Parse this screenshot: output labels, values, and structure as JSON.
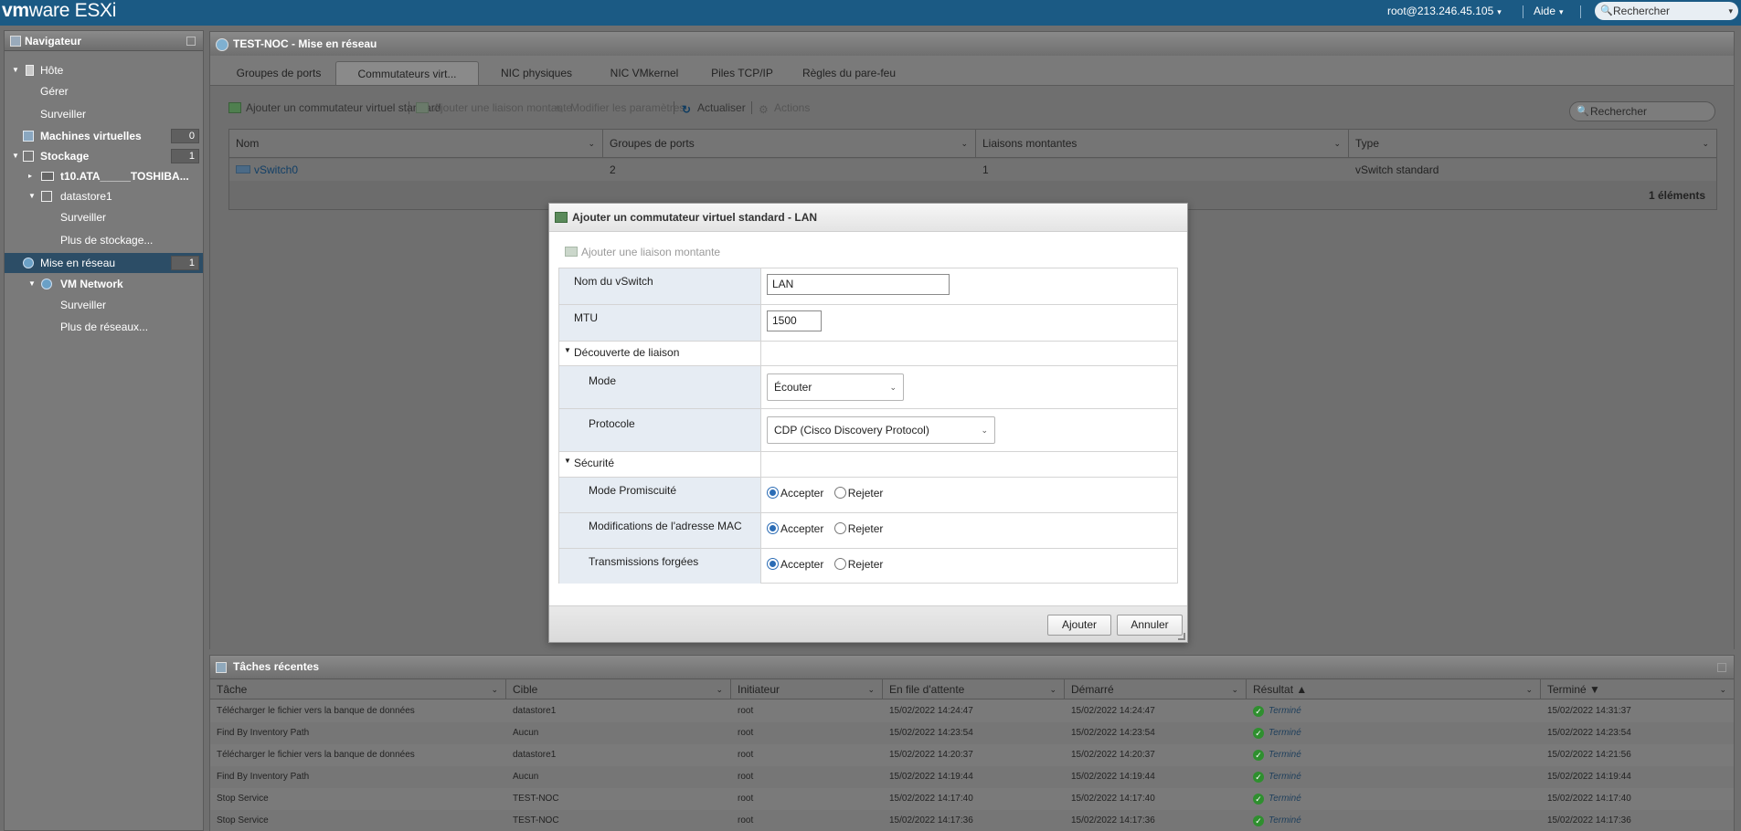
{
  "app": {
    "logo_vm": "vm",
    "logo_ware": "ware",
    "logo_product": " ESXi",
    "user": "root@213.246.45.105",
    "help": "Aide",
    "search_placeholder": "Rechercher"
  },
  "navigator": {
    "title": "Navigateur",
    "items": [
      {
        "label": "Hôte"
      },
      {
        "label": "Gérer"
      },
      {
        "label": "Surveiller"
      },
      {
        "label": "Machines virtuelles",
        "count": "0"
      },
      {
        "label": "Stockage",
        "count": "1"
      },
      {
        "label": "t10.ATA_____TOSHIBA..."
      },
      {
        "label": "datastore1"
      },
      {
        "label": "Surveiller"
      },
      {
        "label": "Plus de stockage..."
      },
      {
        "label": "Mise en réseau",
        "count": "1"
      },
      {
        "label": "VM Network"
      },
      {
        "label": "Surveiller"
      },
      {
        "label": "Plus de réseaux..."
      }
    ]
  },
  "main": {
    "title": "TEST-NOC - Mise en réseau",
    "tabs": [
      {
        "label": "Groupes de ports"
      },
      {
        "label": "Commutateurs virt..."
      },
      {
        "label": "NIC physiques"
      },
      {
        "label": "NIC VMkernel"
      },
      {
        "label": "Piles TCP/IP"
      },
      {
        "label": "Règles du pare-feu"
      }
    ],
    "toolbar": {
      "add_switch": "Ajouter un commutateur virtuel standard",
      "add_uplink": "Ajouter une liaison montante",
      "edit_settings": "Modifier les paramètres",
      "refresh": "Actualiser",
      "actions": "Actions"
    },
    "search_placeholder": "Rechercher",
    "grid": {
      "columns": [
        "Nom",
        "Groupes de ports",
        "Liaisons montantes",
        "Type"
      ],
      "rows": [
        {
          "name": "vSwitch0",
          "port_groups": "2",
          "uplinks": "1",
          "type": "vSwitch standard"
        }
      ],
      "footer": "1 éléments"
    }
  },
  "tasks": {
    "title": "Tâches récentes",
    "columns": [
      "Tâche",
      "Cible",
      "Initiateur",
      "En file d'attente",
      "Démarré",
      "Résultat ▲",
      "Terminé ▼"
    ],
    "rows": [
      {
        "task": "Télécharger le fichier vers la banque de données",
        "target": "datastore1",
        "initiator": "root",
        "queued": "15/02/2022 14:24:47",
        "started": "15/02/2022 14:24:47",
        "result": "Terminé",
        "completed": "15/02/2022 14:31:37"
      },
      {
        "task": "Find By Inventory Path",
        "target": "Aucun",
        "initiator": "root",
        "queued": "15/02/2022 14:23:54",
        "started": "15/02/2022 14:23:54",
        "result": "Terminé",
        "completed": "15/02/2022 14:23:54"
      },
      {
        "task": "Télécharger le fichier vers la banque de données",
        "target": "datastore1",
        "initiator": "root",
        "queued": "15/02/2022 14:20:37",
        "started": "15/02/2022 14:20:37",
        "result": "Terminé",
        "completed": "15/02/2022 14:21:56"
      },
      {
        "task": "Find By Inventory Path",
        "target": "Aucun",
        "initiator": "root",
        "queued": "15/02/2022 14:19:44",
        "started": "15/02/2022 14:19:44",
        "result": "Terminé",
        "completed": "15/02/2022 14:19:44"
      },
      {
        "task": "Stop Service",
        "target": "TEST-NOC",
        "initiator": "root",
        "queued": "15/02/2022 14:17:40",
        "started": "15/02/2022 14:17:40",
        "result": "Terminé",
        "completed": "15/02/2022 14:17:40"
      },
      {
        "task": "Stop Service",
        "target": "TEST-NOC",
        "initiator": "root",
        "queued": "15/02/2022 14:17:36",
        "started": "15/02/2022 14:17:36",
        "result": "Terminé",
        "completed": "15/02/2022 14:17:36"
      }
    ]
  },
  "modal": {
    "title": "Ajouter un commutateur virtuel standard - LAN",
    "add_uplink": "Ajouter une liaison montante",
    "fields": {
      "vswitch_name_label": "Nom du vSwitch",
      "vswitch_name_value": "LAN",
      "mtu_label": "MTU",
      "mtu_value": "1500",
      "link_discovery_section": "Découverte de liaison",
      "mode_label": "Mode",
      "mode_value": "Écouter",
      "protocol_label": "Protocole",
      "protocol_value": "CDP (Cisco Discovery Protocol)",
      "security_section": "Sécurité",
      "promiscuous_label": "Mode Promiscuité",
      "mac_changes_label": "Modifications de l'adresse MAC",
      "forged_label": "Transmissions forgées",
      "accept": "Accepter",
      "reject": "Rejeter"
    },
    "add_button": "Ajouter",
    "cancel_button": "Annuler"
  }
}
